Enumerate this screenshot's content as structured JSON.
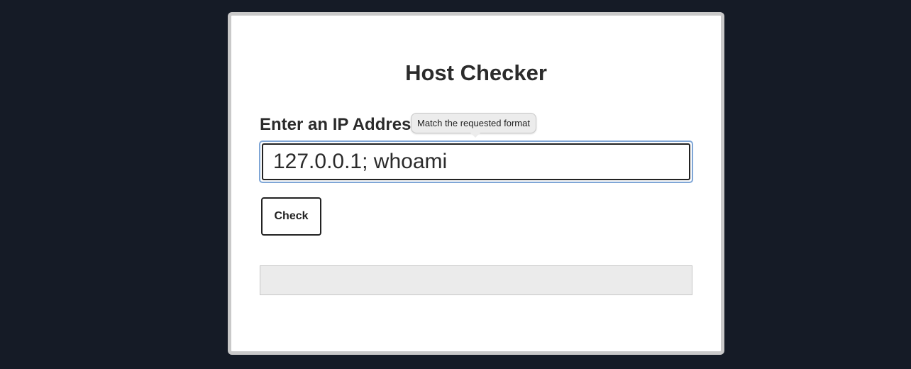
{
  "page": {
    "title": "Host Checker"
  },
  "form": {
    "ip_label": "Enter an IP Address",
    "ip_value": "127.0.0.1; whoami",
    "validation_tooltip": "Match the requested format",
    "submit_label": "Check"
  },
  "result": {
    "text": ""
  },
  "colors": {
    "background": "#151b26",
    "card": "#ffffff",
    "focus_ring": "#7fa6d6",
    "result_box": "#ebebeb"
  }
}
